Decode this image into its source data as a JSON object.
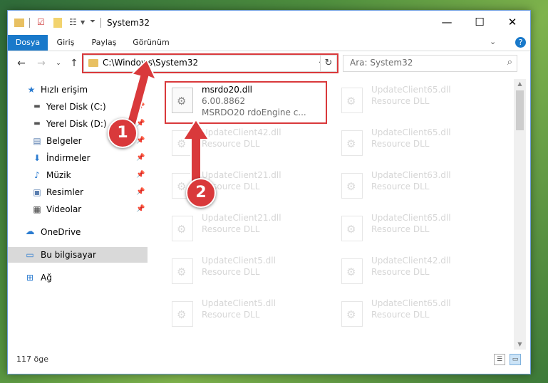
{
  "window": {
    "title": "System32",
    "controls": {
      "minimize": "—",
      "maximize": "☐",
      "close": "✕"
    }
  },
  "ribbon": {
    "tabs": [
      {
        "label": "Dosya",
        "active": true
      },
      {
        "label": "Giriş"
      },
      {
        "label": "Paylaş"
      },
      {
        "label": "Görünüm"
      }
    ],
    "help": "?"
  },
  "address_bar": {
    "path": "C:\\Windows\\System32",
    "search_placeholder": "Ara: System32"
  },
  "nav_pane": {
    "items": [
      {
        "label": "Hızlı erişim",
        "icon": "star-icon",
        "pinned": false
      },
      {
        "label": "Yerel Disk (C:)",
        "icon": "drive-icon",
        "pinned": true
      },
      {
        "label": "Yerel Disk (D:)",
        "icon": "drive-icon",
        "pinned": true
      },
      {
        "label": "Belgeler",
        "icon": "documents-icon",
        "pinned": true
      },
      {
        "label": "İndirmeler",
        "icon": "download-icon",
        "pinned": true
      },
      {
        "label": "Müzik",
        "icon": "music-icon",
        "pinned": true
      },
      {
        "label": "Resimler",
        "icon": "pictures-icon",
        "pinned": true
      },
      {
        "label": "Videolar",
        "icon": "video-icon",
        "pinned": true
      },
      {
        "label": "OneDrive",
        "icon": "cloud-icon",
        "pinned": false
      },
      {
        "label": "Bu bilgisayar",
        "icon": "computer-icon",
        "selected": true
      },
      {
        "label": "Ağ",
        "icon": "network-icon",
        "pinned": false
      }
    ]
  },
  "files": {
    "left_column": [
      {
        "name": "msrdo20.dll",
        "line2": "6.00.8862",
        "line3": "MSRDO20 rdoEngine c...",
        "highlighted": true
      },
      {
        "name": "UpdateClient42.dll",
        "line2": "Resource DLL"
      },
      {
        "name": "UpdateClient21.dll",
        "line2": "Resource DLL"
      },
      {
        "name": "UpdateClient21.dll",
        "line2": "Resource DLL"
      },
      {
        "name": "UpdateClient5.dll",
        "line2": "Resource DLL"
      },
      {
        "name": "UpdateClient5.dll",
        "line2": "Resource DLL"
      }
    ],
    "right_column": [
      {
        "name": "UpdateClient65.dll",
        "line2": "Resource DLL"
      },
      {
        "name": "UpdateClient65.dll",
        "line2": "Resource DLL"
      },
      {
        "name": "UpdateClient63.dll",
        "line2": "Resource DLL"
      },
      {
        "name": "UpdateClient65.dll",
        "line2": "Resource DLL"
      },
      {
        "name": "UpdateClient42.dll",
        "line2": "Resource DLL"
      },
      {
        "name": "UpdateClient65.dll",
        "line2": "Resource DLL"
      }
    ]
  },
  "status_bar": {
    "item_count": "117 öge"
  },
  "annotations": {
    "step1": "1",
    "step2": "2"
  },
  "colors": {
    "accent": "#1979ca",
    "highlight": "#d9393b"
  }
}
